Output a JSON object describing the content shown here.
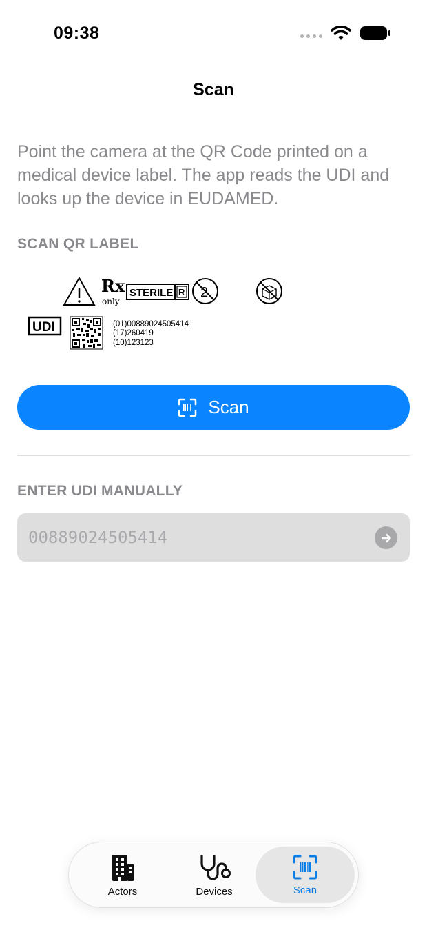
{
  "status_bar": {
    "time": "09:38",
    "icons": [
      "signal-dots-icon",
      "wifi-icon",
      "battery-icon"
    ]
  },
  "nav": {
    "title": "Scan"
  },
  "intro_text": "Point the camera at the QR Code printed on a medical device label. The app reads the UDI and looks up the device in EUDAMED.",
  "scan_section": {
    "header": "SCAN QR LABEL",
    "label_image": {
      "rx": "Rx",
      "rx_only": "only",
      "sterile": "STERILE",
      "sterile_r": "R",
      "udi": "UDI",
      "lines": [
        "(01)00889024505414",
        "(17)260419",
        "(10)123123"
      ],
      "icons": [
        "warning-icon",
        "no-reuse-icon",
        "do-not-use-if-damaged-icon",
        "qr-code-icon"
      ]
    },
    "scan_button_label": "Scan",
    "scan_button_icon": "barcode-viewfinder-icon"
  },
  "manual_section": {
    "header": "ENTER UDI MANUALLY",
    "placeholder": "00889024505414",
    "value": "",
    "submit_icon": "arrow-right-circle-icon"
  },
  "tab_bar": {
    "selected": "Scan",
    "tabs": [
      {
        "label": "Actors",
        "icon": "building-icon"
      },
      {
        "label": "Devices",
        "icon": "stethoscope-icon"
      },
      {
        "label": "Scan",
        "icon": "barcode-viewfinder-icon"
      }
    ]
  },
  "colors": {
    "accent": "#0a84ff",
    "tab_selected_text": "#0a7ee8",
    "secondary_text": "#8a8a8e",
    "field_background": "#dedede"
  }
}
